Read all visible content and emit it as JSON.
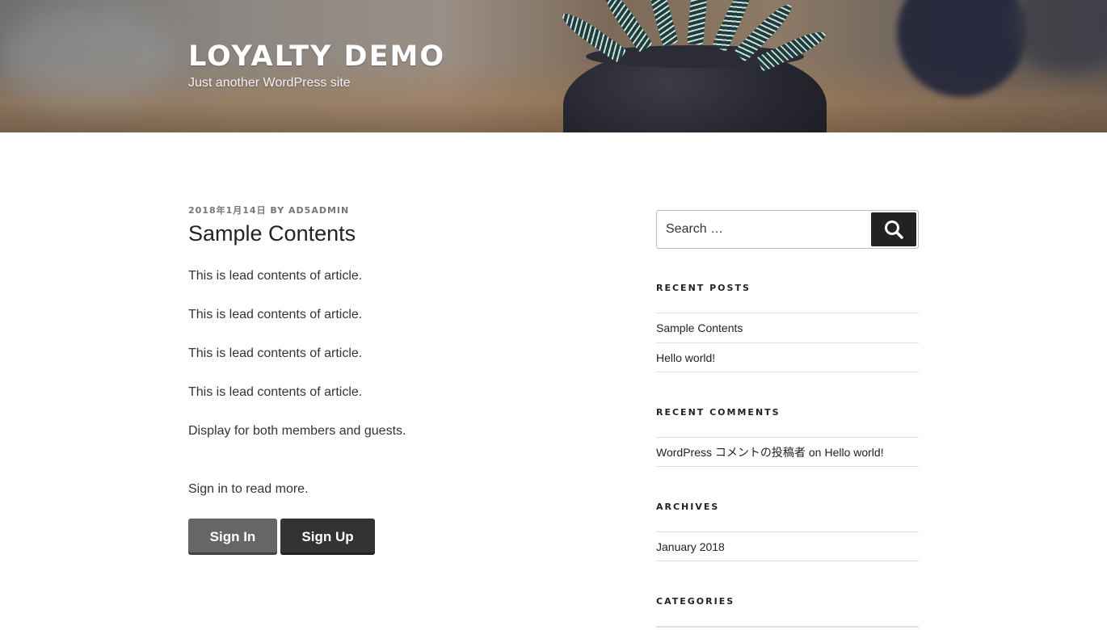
{
  "header": {
    "site_title": "LOYALTY DEMO",
    "site_description": "Just another WordPress site"
  },
  "article": {
    "date": "2018年1月14日",
    "by": "BY",
    "author": "AD5ADMIN",
    "title": "Sample Contents",
    "paragraphs": [
      "This is lead contents of article.",
      "This is lead contents of article.",
      "This is lead contents of article.",
      "This is lead contents of article.",
      "Display for both members and guests.",
      "Sign in to read more."
    ],
    "sign_in_label": "Sign In",
    "sign_up_label": "Sign Up"
  },
  "sidebar": {
    "search_placeholder": "Search …",
    "recent_posts": {
      "title": "RECENT POSTS",
      "items": [
        "Sample Contents",
        "Hello world!"
      ]
    },
    "recent_comments": {
      "title": "RECENT COMMENTS",
      "author": "WordPress コメントの投稿者",
      "on": "on",
      "post": "Hello world!"
    },
    "archives": {
      "title": "ARCHIVES",
      "items": [
        "January 2018"
      ]
    },
    "categories": {
      "title": "CATEGORIES"
    }
  },
  "colors": {
    "text": "#222222",
    "meta": "#767676",
    "button_sign_in": "#666666",
    "button_sign_up": "#333333",
    "search_button": "#222222"
  }
}
